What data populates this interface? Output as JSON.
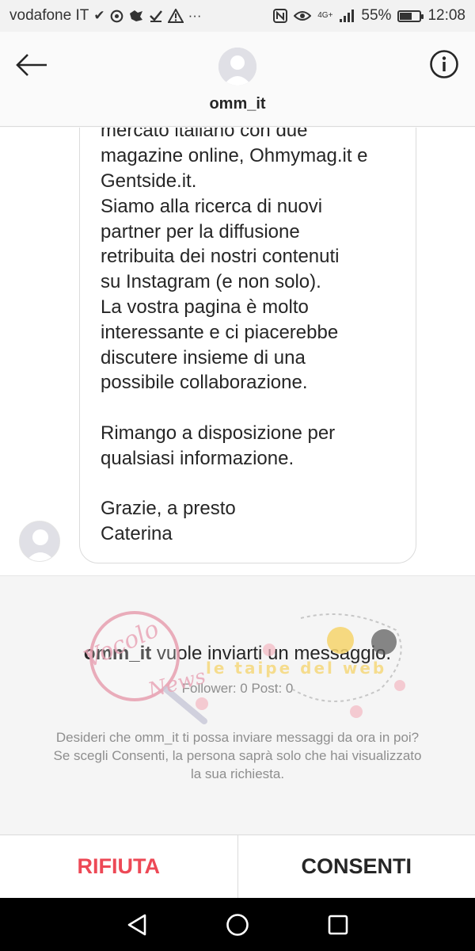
{
  "status_bar": {
    "carrier": "vodafone IT",
    "network": "4G+",
    "battery": "55%",
    "battery_level": 0.55,
    "time": "12:08",
    "icons": [
      "check-icon",
      "chrome-icon",
      "puzzle-icon",
      "check-icon",
      "warning-icon",
      "more-icon",
      "nfc-icon",
      "eye-icon",
      "signal-icon",
      "battery-icon"
    ]
  },
  "header": {
    "username": "omm_it",
    "back_icon": "arrow-left-icon",
    "info_icon": "info-icon"
  },
  "message": {
    "text": "mercato italiano con due\nmagazine online, Ohmymag.it e\nGentside.it.\nSiamo alla ricerca di nuovi\npartner per la diffusione\nretribuita dei nostri contenuti\nsu Instagram (e non solo).\nLa vostra pagina è molto\ninteressante e ci piacerebbe\ndiscutere insieme di una\npossibile collaborazione.\n\nRimango a disposizione per\nqualsiasi informazione.\n\nGrazie, a presto\nCaterina"
  },
  "request": {
    "username": "omm_it",
    "title_suffix": " vuole inviarti un messaggio.",
    "stats": "Follower: 0 Post: 0",
    "description": "Desideri che omm_it ti possa inviare messaggi da ora in poi? Se scegli Consenti, la persona saprà solo che hai visualizzato la sua richiesta."
  },
  "watermark": {
    "left_text": "Vocolo delle News",
    "right_text": "le taipe del web"
  },
  "actions": {
    "decline": "RIFIUTA",
    "accept": "CONSENTI"
  },
  "colors": {
    "decline": "#ed4956",
    "accept": "#262626",
    "secondary_text": "#8e8e8e"
  },
  "nav_bar": {
    "icons": [
      "back-triangle-icon",
      "home-circle-icon",
      "recents-square-icon"
    ]
  }
}
